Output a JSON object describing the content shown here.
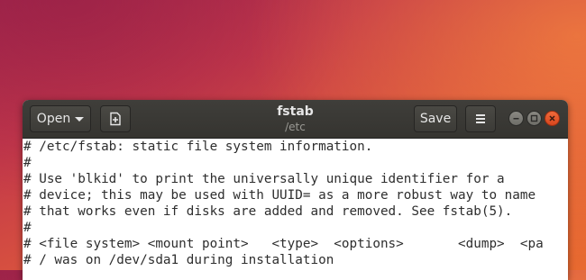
{
  "toolbar": {
    "open_label": "Open",
    "save_label": "Save"
  },
  "header": {
    "title": "fstab",
    "subtitle": "/etc"
  },
  "icons": {
    "open_caret": "chevron-down-icon",
    "new_document": "new-document-icon",
    "menu": "hamburger-menu-icon",
    "minimize": "minimize-icon",
    "maximize": "maximize-icon",
    "close": "close-icon"
  },
  "colors": {
    "titlebar": "#3c3b37",
    "close_button": "#e2522a",
    "editor_background": "#ffffff",
    "text": "#2e2e2e"
  },
  "editor": {
    "lines": [
      "# /etc/fstab: static file system information.",
      "#",
      "# Use 'blkid' to print the universally unique identifier for a",
      "# device; this may be used with UUID= as a more robust way to name",
      "# that works even if disks are added and removed. See fstab(5).",
      "#",
      "# <file system> <mount point>   <type>  <options>       <dump>  <pa",
      "# / was on /dev/sda1 during installation"
    ]
  }
}
